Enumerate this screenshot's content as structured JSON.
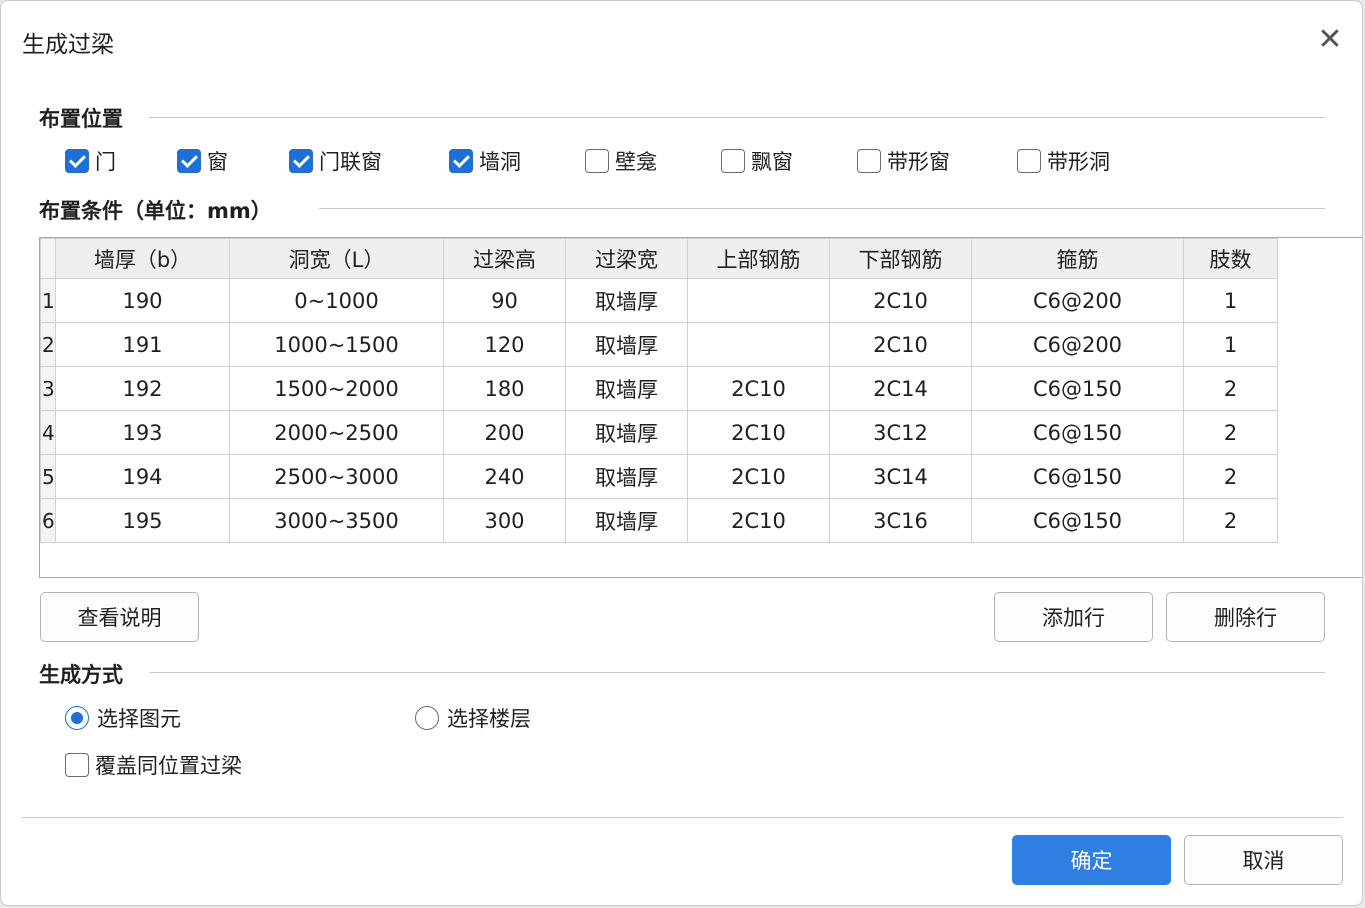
{
  "dialog": {
    "title": "生成过梁",
    "close_glyph": "✕"
  },
  "placement": {
    "label": "布置位置",
    "items": [
      {
        "label": "门",
        "checked": true
      },
      {
        "label": "窗",
        "checked": true
      },
      {
        "label": "门联窗",
        "checked": true
      },
      {
        "label": "墙洞",
        "checked": true
      },
      {
        "label": "壁龛",
        "checked": false
      },
      {
        "label": "飘窗",
        "checked": false
      },
      {
        "label": "带形窗",
        "checked": false
      },
      {
        "label": "带形洞",
        "checked": false
      }
    ]
  },
  "conditions": {
    "label": "布置条件（单位：mm）",
    "columns": [
      "墙厚（b）",
      "洞宽（L）",
      "过梁高",
      "过梁宽",
      "上部钢筋",
      "下部钢筋",
      "箍筋",
      "肢数"
    ],
    "rows": [
      {
        "n": "1",
        "cells": [
          "190",
          "0~1000",
          "90",
          "取墙厚",
          "",
          "2C10",
          "C6@200",
          "1"
        ]
      },
      {
        "n": "2",
        "cells": [
          "191",
          "1000~1500",
          "120",
          "取墙厚",
          "",
          "2C10",
          "C6@200",
          "1"
        ]
      },
      {
        "n": "3",
        "cells": [
          "192",
          "1500~2000",
          "180",
          "取墙厚",
          "2C10",
          "2C14",
          "C6@150",
          "2"
        ]
      },
      {
        "n": "4",
        "cells": [
          "193",
          "2000~2500",
          "200",
          "取墙厚",
          "2C10",
          "3C12",
          "C6@150",
          "2"
        ]
      },
      {
        "n": "5",
        "cells": [
          "194",
          "2500~3000",
          "240",
          "取墙厚",
          "2C10",
          "3C14",
          "C6@150",
          "2"
        ]
      },
      {
        "n": "6",
        "cells": [
          "195",
          "3000~3500",
          "300",
          "取墙厚",
          "2C10",
          "3C16",
          "C6@150",
          "2"
        ]
      }
    ]
  },
  "buttons": {
    "view_help": "查看说明",
    "add_row": "添加行",
    "delete_row": "删除行",
    "ok": "确定",
    "cancel": "取消"
  },
  "method": {
    "label": "生成方式",
    "select_element": "选择图元",
    "select_floor": "选择楼层",
    "select_element_on": true,
    "overwrite": "覆盖同位置过梁",
    "overwrite_checked": false
  },
  "colors": {
    "accent": "#2f7fe3",
    "check": "#1e6fd6"
  }
}
